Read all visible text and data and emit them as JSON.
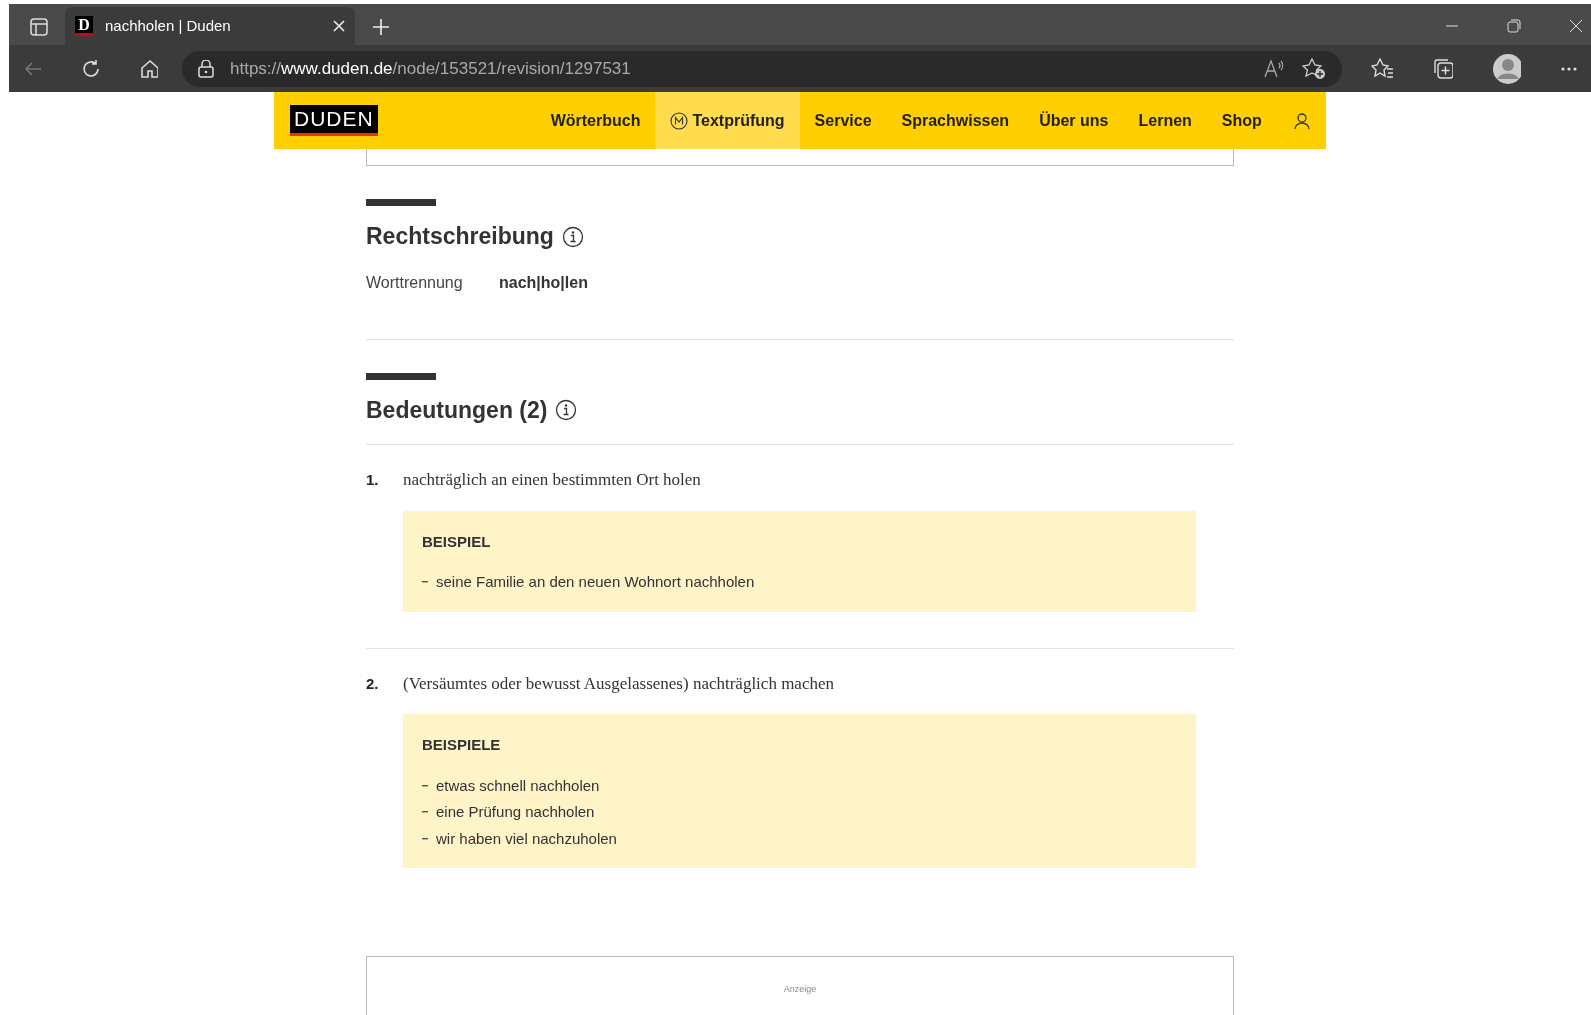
{
  "browser": {
    "favicon": "D",
    "tab_title": "nachholen | Duden",
    "url": {
      "scheme": "https://",
      "host": "www.duden.de",
      "path": "/node/153521/revision/1297531"
    }
  },
  "site": {
    "logo": "DUDEN",
    "nav": [
      {
        "label": "Wörterbuch",
        "selected": false,
        "badge": false
      },
      {
        "label": "Textprüfung",
        "selected": true,
        "badge": true
      },
      {
        "label": "Service",
        "selected": false,
        "badge": false
      },
      {
        "label": "Sprachwissen",
        "selected": false,
        "badge": false
      },
      {
        "label": "Über uns",
        "selected": false,
        "badge": false
      },
      {
        "label": "Lernen",
        "selected": false,
        "badge": false
      },
      {
        "label": "Shop",
        "selected": false,
        "badge": false
      }
    ]
  },
  "rechtschreibung": {
    "title": "Rechtschreibung",
    "label": "Worttrennung",
    "value": "nach|ho|len"
  },
  "bedeutungen": {
    "title": "Bedeutungen (2)",
    "items": [
      {
        "number": "1.",
        "text": "nachträglich an einen bestimmten Ort holen",
        "example_label": "BEISPIEL",
        "examples": [
          "seine Familie an den neuen Wohnort nachholen"
        ]
      },
      {
        "number": "2.",
        "text": "(Versäumtes oder bewusst Ausgelassenes) nachträglich machen",
        "example_label": "BEISPIELE",
        "examples": [
          "etwas schnell nachholen",
          "eine Prüfung nachholen",
          "wir haben viel nachzuholen"
        ]
      }
    ]
  },
  "ad": {
    "label": "Anzeige"
  }
}
